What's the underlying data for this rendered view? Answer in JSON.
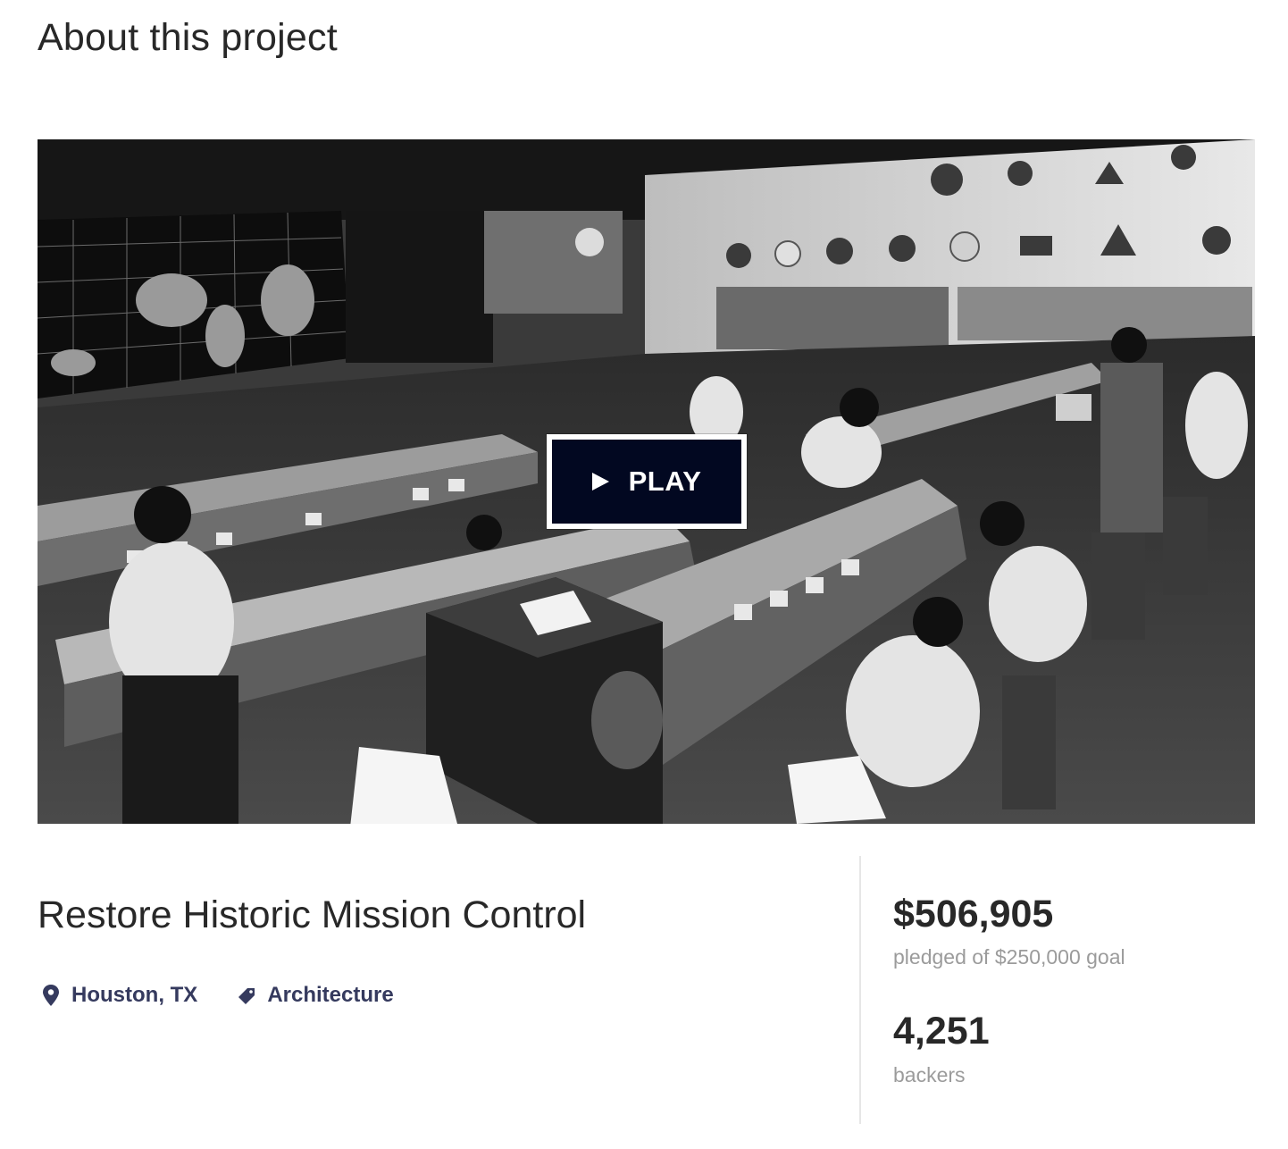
{
  "section": {
    "title": "About this project"
  },
  "video": {
    "thumbnail_description_icon": "mission-control-photo",
    "play_label": "PLAY",
    "play_icon": "play-icon"
  },
  "project": {
    "title": "Restore Historic Mission Control",
    "location": {
      "icon": "location-pin-icon",
      "label": "Houston, TX"
    },
    "category": {
      "icon": "tag-icon",
      "label": "Architecture"
    }
  },
  "stats": {
    "pledged": {
      "value": "$506,905",
      "label": "pledged of $250,000 goal"
    },
    "backers": {
      "value": "4,251",
      "label": "backers"
    }
  },
  "colors": {
    "play_button_bg": "#020821",
    "link": "#353a5e",
    "text": "#282828",
    "muted": "#9b9b9b"
  }
}
